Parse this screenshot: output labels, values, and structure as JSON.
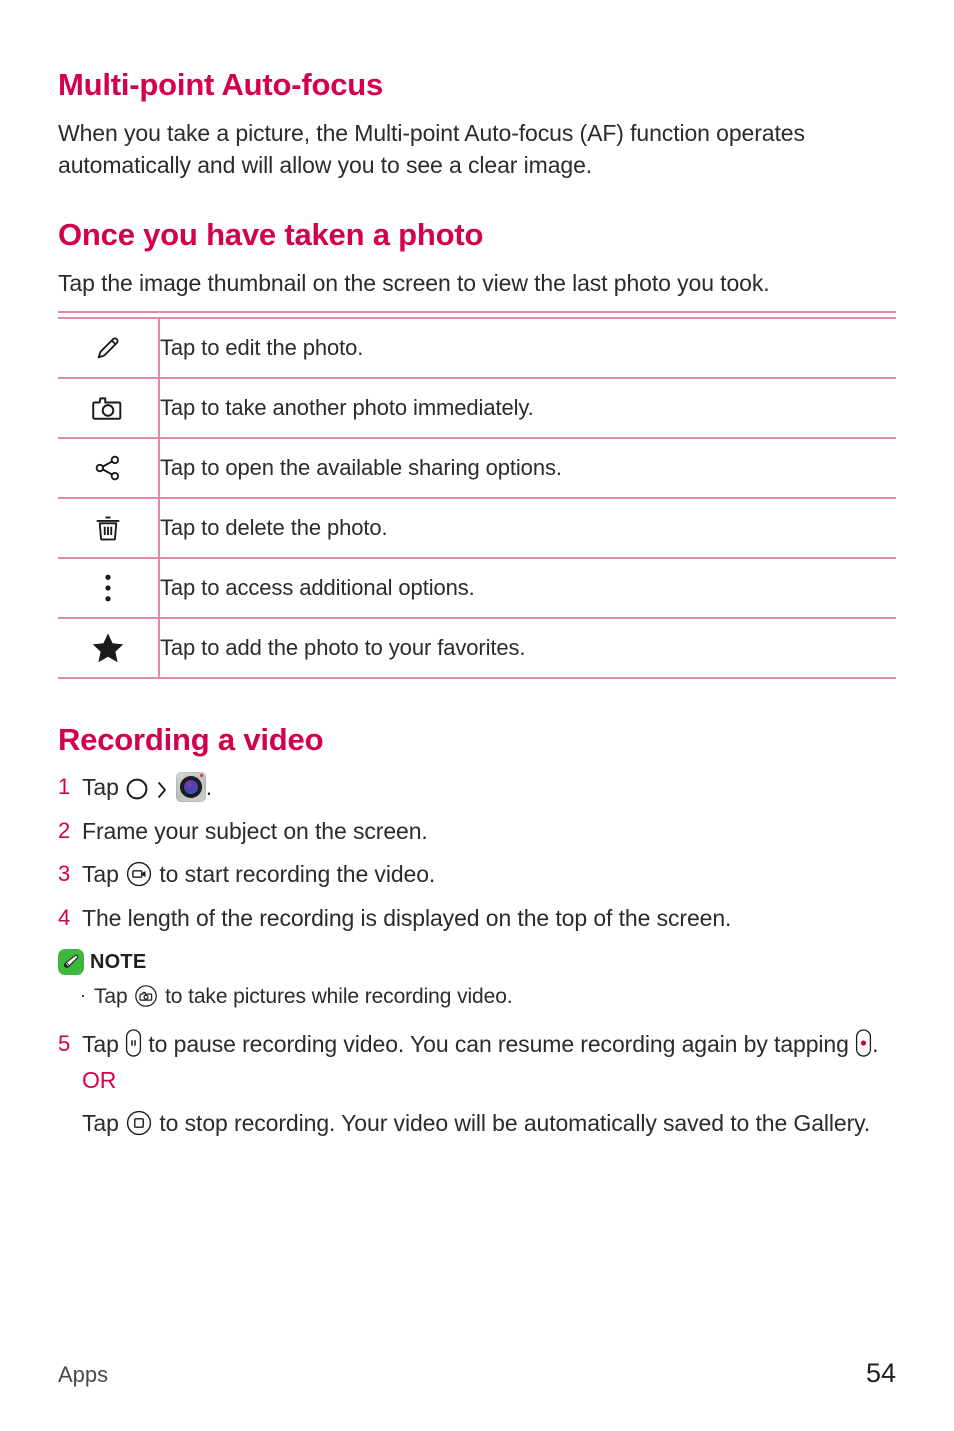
{
  "colors": {
    "accent": "#d3004e",
    "table_rule": "#e38aa3",
    "body_text": "#2b2b2b",
    "note_badge_green": "#3db83d",
    "record_dot_red": "#d3004e"
  },
  "sections": {
    "multipoint": {
      "heading": "Multi-point Auto-focus",
      "paragraph": "When you take a picture, the Multi-point Auto-focus (AF) function operates automatically and will allow you to see a clear image."
    },
    "once_taken": {
      "heading": "Once you have taken a photo",
      "lead": "Tap the image thumbnail on the screen to view the last photo you took.",
      "rows": [
        {
          "icon": "pencil-icon",
          "description": "Tap to edit the photo."
        },
        {
          "icon": "camera-icon",
          "description": "Tap to take another photo immediately."
        },
        {
          "icon": "share-icon",
          "description": "Tap to open the available sharing options."
        },
        {
          "icon": "trash-icon",
          "description": "Tap to delete the photo."
        },
        {
          "icon": "overflow-menu-icon",
          "description": "Tap to access additional options."
        },
        {
          "icon": "star-icon",
          "description": "Tap to add the photo to your favorites."
        }
      ]
    },
    "recording": {
      "heading": "Recording a video",
      "steps": [
        {
          "number": "1",
          "pre": "Tap",
          "icons": [
            "home-circle-icon",
            "chevron-right-icon",
            "camera-app-icon"
          ],
          "post": "."
        },
        {
          "number": "2",
          "text": "Frame your subject on the screen."
        },
        {
          "number": "3",
          "pre": "Tap",
          "icon": "video-record-icon",
          "post": "to start recording the video."
        },
        {
          "number": "4",
          "text": "The length of the recording is displayed on the top of the screen."
        },
        {
          "number": "5",
          "pre": "Tap",
          "icon": "pause-pill-icon",
          "mid": "to pause recording video. You can resume recording again by tapping",
          "icon2": "record-dot-pill-icon",
          "post": ".",
          "or_label": "OR",
          "alt_pre": "Tap",
          "alt_icon": "stop-circle-icon",
          "alt_post": "to stop recording. Your video will be automatically saved to the Gallery."
        }
      ],
      "note": {
        "badge_icon": "note-pen-badge-icon",
        "label": "NOTE",
        "bullet": "·",
        "item_pre": "Tap",
        "item_icon": "camera-circle-icon",
        "item_post": "to take pictures while recording video."
      }
    }
  },
  "footer": {
    "chapter": "Apps",
    "page_number": "54"
  }
}
